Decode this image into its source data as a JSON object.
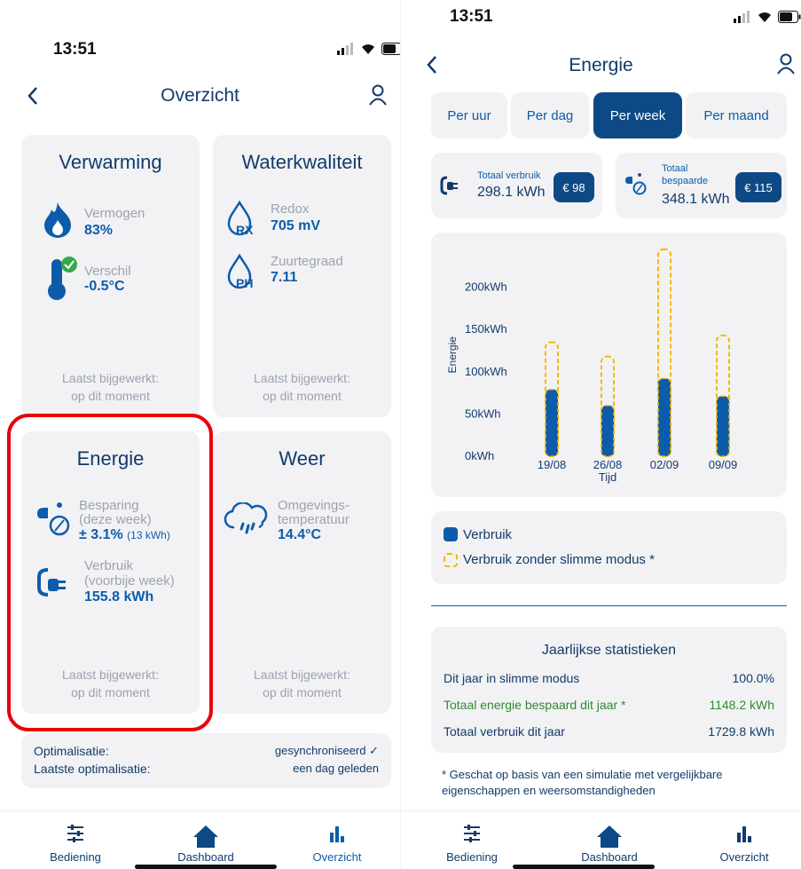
{
  "left": {
    "time": "13:51",
    "nav_title": "Overzicht",
    "heating": {
      "title": "Verwarming",
      "power_label": "Vermogen",
      "power_value": "83%",
      "diff_label": "Verschil",
      "diff_value": "-0.5°C",
      "updated_1": "Laatst bijgewerkt:",
      "updated_2": "op dit moment"
    },
    "water": {
      "title": "Waterkwaliteit",
      "redox_label": "Redox",
      "redox_value": "705 mV",
      "redox_icon_text": "RX",
      "ph_label": "Zuurtegraad",
      "ph_value": "7.11",
      "ph_icon_text": "PH",
      "updated_1": "Laatst bijgewerkt:",
      "updated_2": "op dit moment"
    },
    "energy": {
      "title": "Energie",
      "saving_label_1": "Besparing",
      "saving_label_2": "(deze week)",
      "saving_value": "± 3.1%",
      "saving_sub": "(13 kWh)",
      "usage_label_1": "Verbruik",
      "usage_label_2": "(voorbije week)",
      "usage_value": "155.8 kWh",
      "updated_1": "Laatst bijgewerkt:",
      "updated_2": "op dit moment"
    },
    "weather": {
      "title": "Weer",
      "temp_label_1": "Omgevings-",
      "temp_label_2": "temperatuur",
      "temp_value": "14.4°C",
      "updated_1": "Laatst bijgewerkt:",
      "updated_2": "op dit moment"
    },
    "optimization": {
      "label_1": "Optimalisatie:",
      "value_1": "gesynchroniseerd ✓",
      "label_2": "Laatste optimalisatie:",
      "value_2": "een dag geleden"
    },
    "tabs": [
      "Bediening",
      "Dashboard",
      "Overzicht"
    ],
    "highlight_color": "#e8000b"
  },
  "right": {
    "time": "13:51",
    "nav_title": "Energie",
    "segments": [
      "Per uur",
      "Per dag",
      "Per week",
      "Per maand"
    ],
    "active_segment": "Per week",
    "total_usage_label": "Totaal verbruik",
    "total_usage_value": "298.1 kWh",
    "total_usage_cost": "€ 98",
    "total_saved_label_1": "Totaal",
    "total_saved_label_2": "bespaarde",
    "total_saved_value": "348.1 kWh",
    "total_saved_cost": "€ 115",
    "legend_1": "Verbruik",
    "legend_2": "Verbruik zonder slimme modus *",
    "stats_title": "Jaarlijkse statistieken",
    "stats": [
      {
        "label": "Dit jaar in slimme modus",
        "value": "100.0%"
      },
      {
        "label": "Totaal energie bespaard dit jaar *",
        "value": "1148.2 kWh"
      },
      {
        "label": "Totaal verbruik dit jaar",
        "value": "1729.8 kWh"
      }
    ],
    "footnote_1": "* Geschat op basis van een simulatie met vergelijkbare",
    "footnote_2": "eigenschappen en weersomstandigheden",
    "tabs": [
      "Bediening",
      "Dashboard",
      "Overzicht"
    ]
  },
  "chart_data": {
    "type": "bar",
    "xlabel": "Tijd",
    "ylabel": "Energie",
    "categories": [
      "19/08",
      "26/08",
      "02/09",
      "09/09"
    ],
    "y_tick_labels": [
      "0kWh",
      "50kWh",
      "100kWh",
      "150kWh",
      "200kWh"
    ],
    "ylim": [
      0,
      250
    ],
    "grid": false,
    "series": [
      {
        "name": "Verbruik",
        "values": [
          79,
          60,
          92,
          71
        ],
        "color": "#0d5cab"
      },
      {
        "name": "Verbruik zonder slimme modus *",
        "values": [
          135,
          118,
          245,
          143
        ],
        "color": "#f5b800"
      }
    ]
  },
  "colors": {
    "accent": "#0d4a85",
    "blue": "#0d5cab",
    "green": "#2e8b2e",
    "yellow": "#f5b800"
  }
}
